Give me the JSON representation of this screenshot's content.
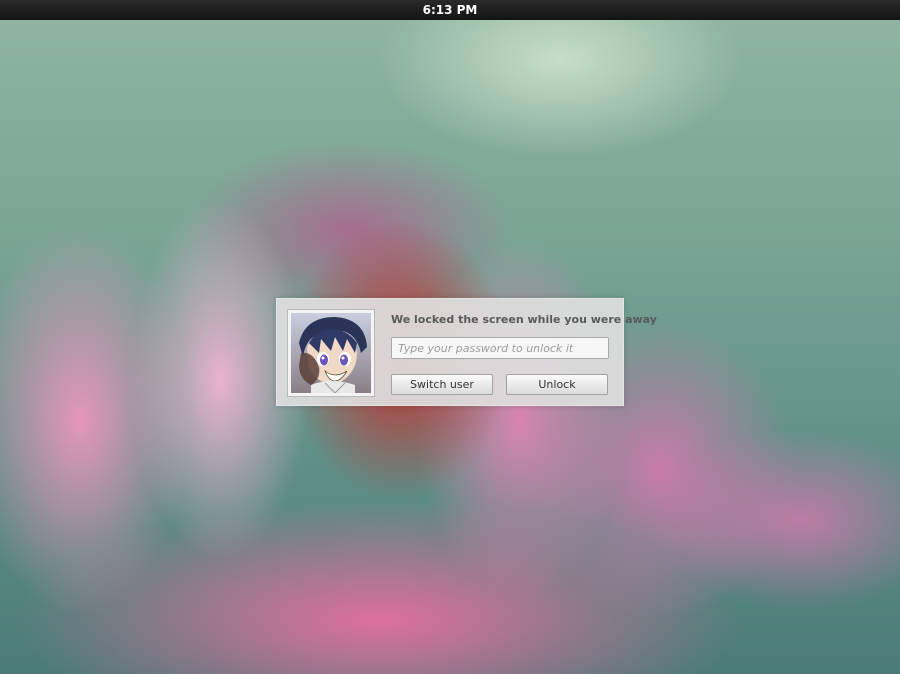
{
  "top_bar": {
    "clock": "6:13 PM"
  },
  "lock_dialog": {
    "message": "We locked the screen while you were away",
    "password_placeholder": "Type your password to unlock it",
    "password_value": "",
    "switch_user_label": "Switch user",
    "unlock_label": "Unlock",
    "avatar_icon": "user-avatar-icon"
  },
  "colors": {
    "top_bar": "#1e1e1e",
    "dialog_background": "#dedede",
    "message_text": "#5a5a5a"
  }
}
